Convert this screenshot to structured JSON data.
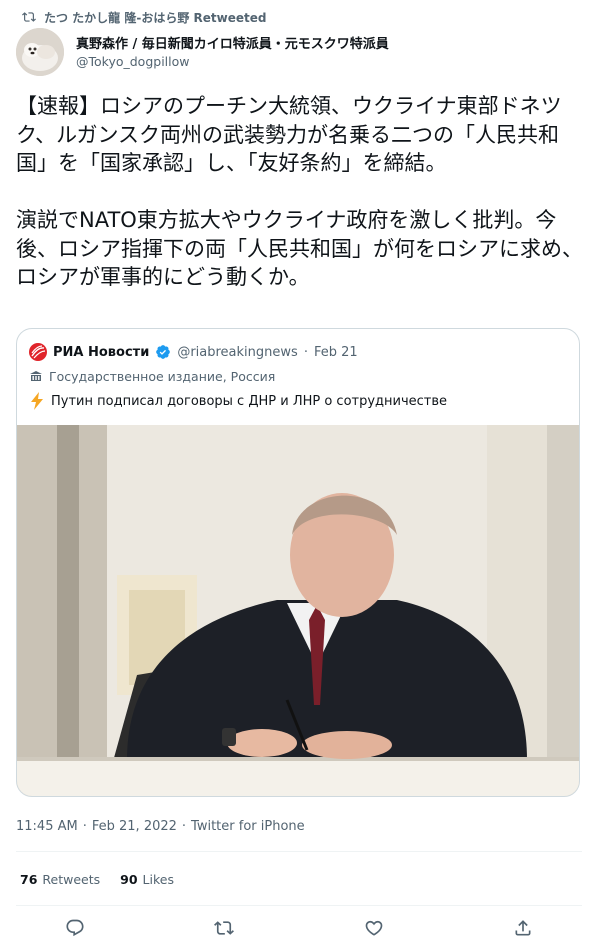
{
  "retweet": {
    "text": "たつ たかし龍 隆-おはら野 Retweeted"
  },
  "author": {
    "name": "真野森作 / 毎日新聞カイロ特派員・元モスクワ特派員",
    "handle": "@Tokyo_dogpillow"
  },
  "tweet": {
    "text": "【速報】ロシアのプーチン大統領、ウクライナ東部ドネツク、ルガンスク両州の武装勢力が名乗る二つの「人民共和国」を「国家承認」し、「友好条約」を締結。\n\n演説でNATO東方拡大やウクライナ政府を激しく批判。今後、ロシア指揮下の両「人民共和国」が何をロシアに求め、ロシアが軍事的にどう動くか。"
  },
  "quote": {
    "name": "РИА Новости",
    "handle": "@riabreakingnews",
    "separator": "·",
    "date": "Feb 21",
    "label": "Государственное издание, Россия",
    "text": "Путин подписал договоры с ДНР и ЛНР о сотрудничестве",
    "icons": {
      "verified": "verified-badge-icon",
      "label": "state-media-icon",
      "text_emoji": "lightning-icon"
    }
  },
  "meta": {
    "time": "11:45 AM",
    "separator": "·",
    "date": "Feb 21, 2022",
    "source": "Twitter for iPhone"
  },
  "stats": {
    "retweets_count": "76",
    "retweets_label": "Retweets",
    "likes_count": "90",
    "likes_label": "Likes"
  },
  "colors": {
    "verified": "#1d9bf0",
    "text": "#0f1419",
    "secondary": "#536471",
    "border": "#cfd9de",
    "ria_red": "#e0242a"
  }
}
